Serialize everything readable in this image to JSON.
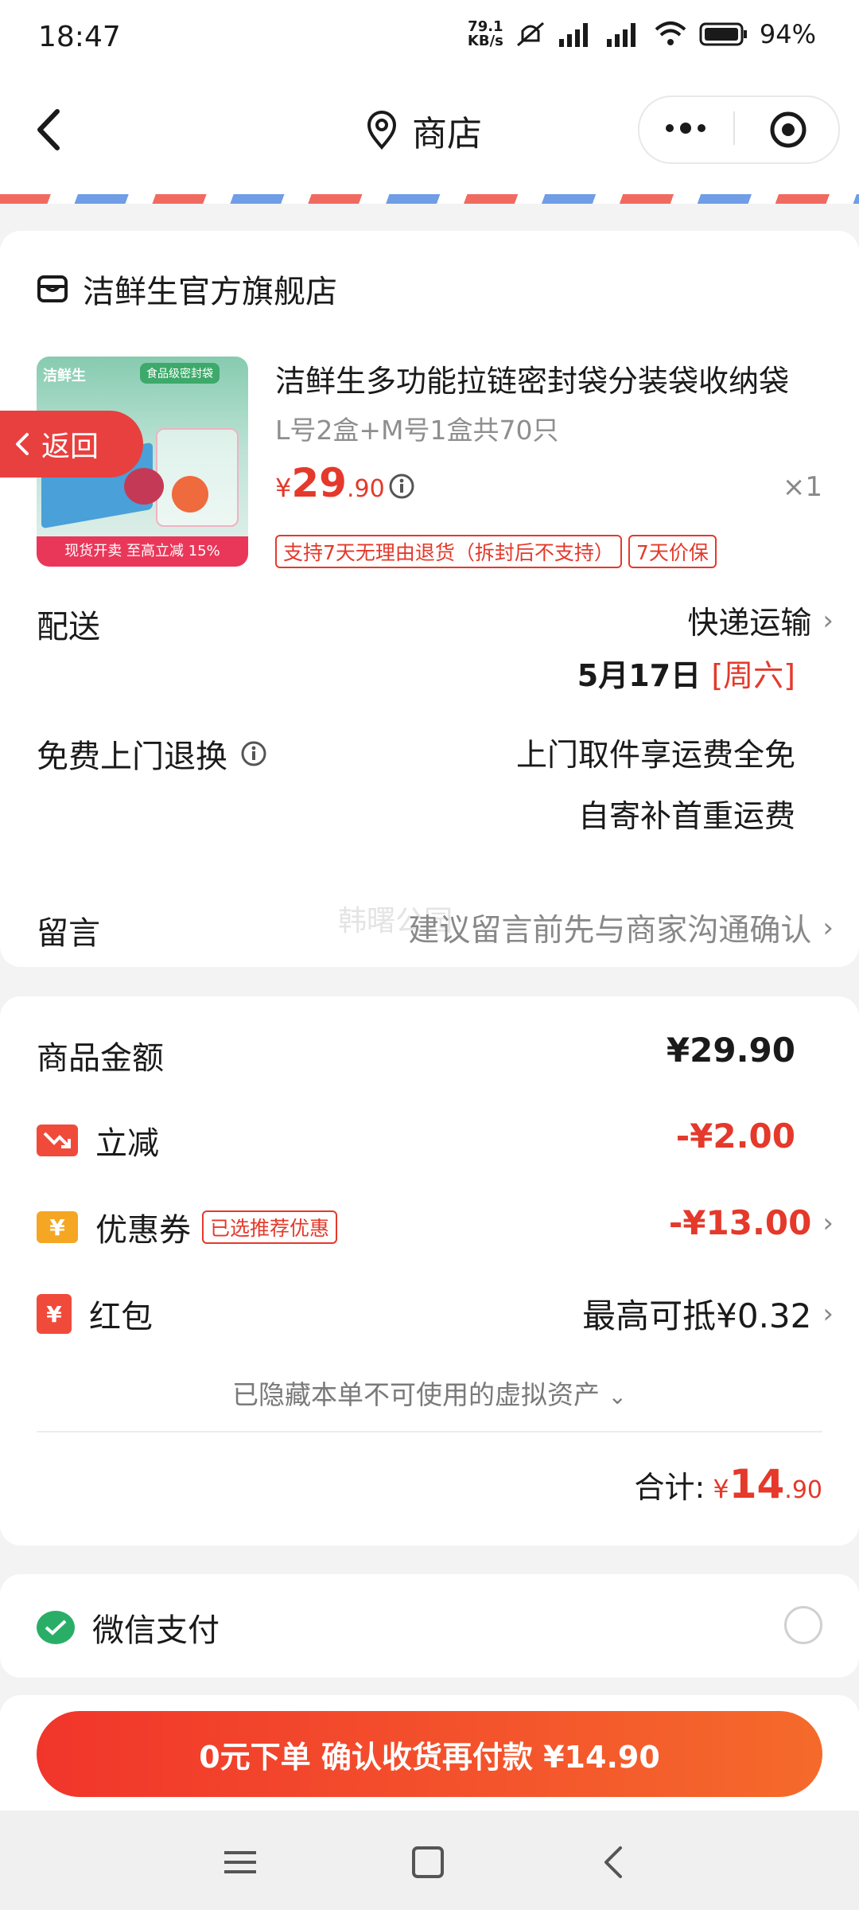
{
  "status_bar": {
    "time": "18:47",
    "net_speed": "79.1",
    "net_unit": "KB/s",
    "battery": "94%",
    "icons": [
      "mute-icon",
      "signal-icon",
      "signal-icon",
      "wifi-icon",
      "battery-icon"
    ]
  },
  "header": {
    "title": "商店",
    "icons": [
      "back-icon",
      "location-pin-icon",
      "more-icon",
      "target-icon"
    ]
  },
  "store": {
    "name": "洁鲜生官方旗舰店",
    "icon": "store-icon"
  },
  "product": {
    "thumb_title": "洁鲜生",
    "thumb_tag": "食品级密封袋",
    "thumb_banner": "现货开卖 至高立减 15%",
    "name": "洁鲜生多功能拉链密封袋分装袋收纳袋",
    "spec": "L号2盒+M号1盒共70只",
    "price_symbol": "¥",
    "price_int": "29",
    "price_dec": ".90",
    "quantity": "×1",
    "tags": [
      "支持7天无理由退货（拆封后不支持）",
      "7天价保"
    ]
  },
  "floating_back": "返回",
  "delivery": {
    "label": "配送",
    "method": "快递运输",
    "date": "5月17日 ",
    "weekday": "[周六]"
  },
  "return": {
    "label": "免费上门退换",
    "line1": "上门取件享运费全免",
    "line2": "自寄补首重运费"
  },
  "message": {
    "label": "留言",
    "placeholder": "建议留言前先与商家沟通确认",
    "watermark": "韩曙公园"
  },
  "summary": {
    "amount_label": "商品金额",
    "amount_value": "¥29.90",
    "discount_label": "立减",
    "discount_value": "-¥2.00",
    "coupon_label": "优惠券",
    "coupon_tag": "已选推荐优惠",
    "coupon_value": "-¥13.00",
    "redpacket_label": "红包",
    "redpacket_value": "最高可抵¥0.32",
    "hidden_note": "已隐藏本单不可使用的虚拟资产",
    "total_label": "合计:",
    "total_symbol": "¥",
    "total_int": "14",
    "total_dec": ".90"
  },
  "payment": {
    "method": "微信支付"
  },
  "pay_button": "0元下单 确认收货再付款 ¥14.90",
  "colors": {
    "accent": "#e4392b",
    "wechat": "#2aae67",
    "button_start": "#f1352b",
    "button_end": "#f56a2b"
  }
}
